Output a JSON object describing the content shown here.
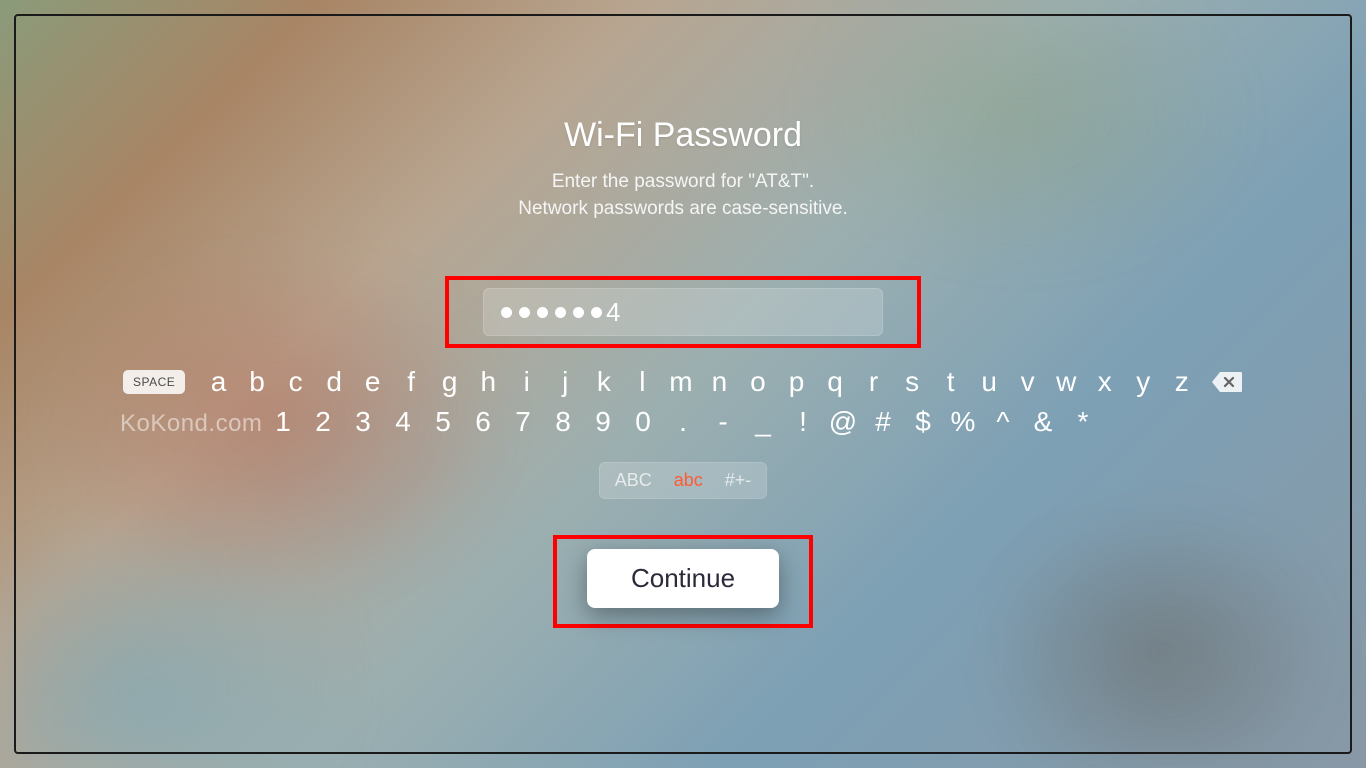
{
  "title": "Wi-Fi Password",
  "subtitle_line1": "Enter the password for \"AT&T\".",
  "subtitle_line2": "Network passwords are case-sensitive.",
  "password": {
    "masked_count": 6,
    "visible_char": "4"
  },
  "keyboard": {
    "space_label": "SPACE",
    "row1": [
      "a",
      "b",
      "c",
      "d",
      "e",
      "f",
      "g",
      "h",
      "i",
      "j",
      "k",
      "l",
      "m",
      "n",
      "o",
      "p",
      "q",
      "r",
      "s",
      "t",
      "u",
      "v",
      "w",
      "x",
      "y",
      "z"
    ],
    "row2": [
      "1",
      "2",
      "3",
      "4",
      "5",
      "6",
      "7",
      "8",
      "9",
      "0",
      ".",
      "-",
      "_",
      "!",
      "@",
      "#",
      "$",
      "%",
      "^",
      "&",
      "*"
    ],
    "modes": {
      "upper": "ABC",
      "lower": "abc",
      "symbols": "#+-"
    },
    "active_mode": "lower"
  },
  "continue_label": "Continue",
  "watermark": "KoKond.com"
}
